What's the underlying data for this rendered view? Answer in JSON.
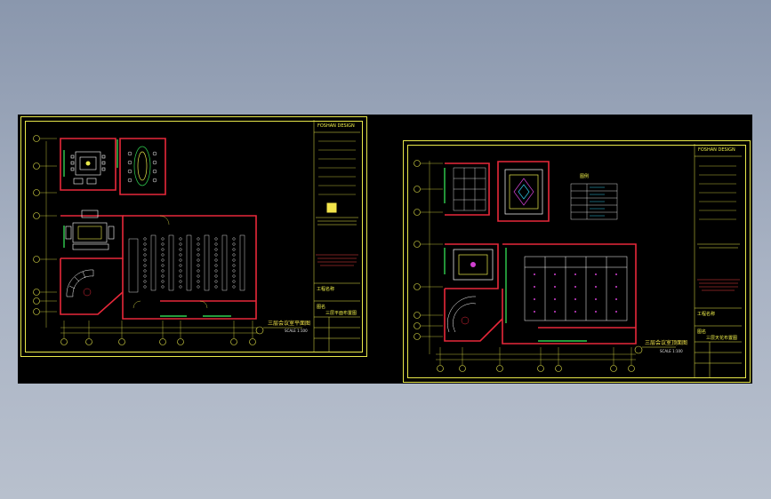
{
  "colors": {
    "background_top": "#8a97ad",
    "viewport": "#000000",
    "frame": "#e8e84a",
    "wall": "#e8283a",
    "furniture": "#ffffff",
    "dimension": "#e8e84a",
    "accent_green": "#30d050",
    "accent_magenta": "#d040d0",
    "accent_cyan": "#30c8e8"
  },
  "sheets": [
    {
      "plan_title": "三层会议室平面图",
      "plan_scale": "SCALE 1:100",
      "title_block": {
        "company": "FOSHAN DESIGN",
        "project_label": "工程名称",
        "drawing_label": "图名",
        "drawing_name": "三层平面布置图"
      }
    },
    {
      "plan_title": "三层会议室顶面图",
      "plan_scale": "SCALE 1:100",
      "title_block": {
        "company": "FOSHAN DESIGN",
        "project_label": "工程名称",
        "drawing_label": "图名",
        "drawing_name": "三层天花布置图"
      },
      "legend_title": "图例"
    }
  ]
}
